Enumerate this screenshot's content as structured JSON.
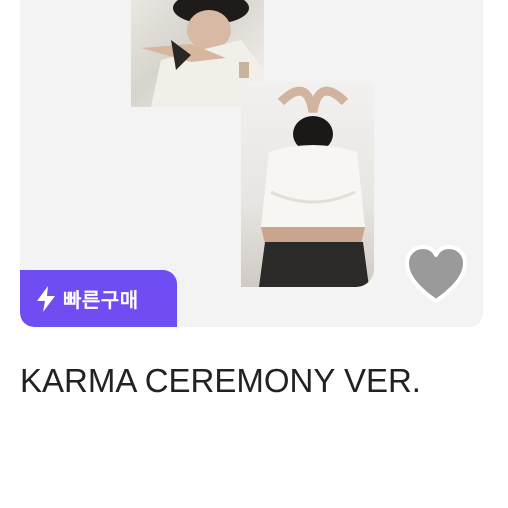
{
  "product": {
    "title": "KARMA CEREMONY VER.",
    "badge_label": "빠른구매",
    "badge_icon": "lightning-icon",
    "favorite_icon": "heart-icon"
  },
  "colors": {
    "badge": "#6f4df2",
    "card_background": "#f3f3f4",
    "heart": "#9a9a9a"
  }
}
